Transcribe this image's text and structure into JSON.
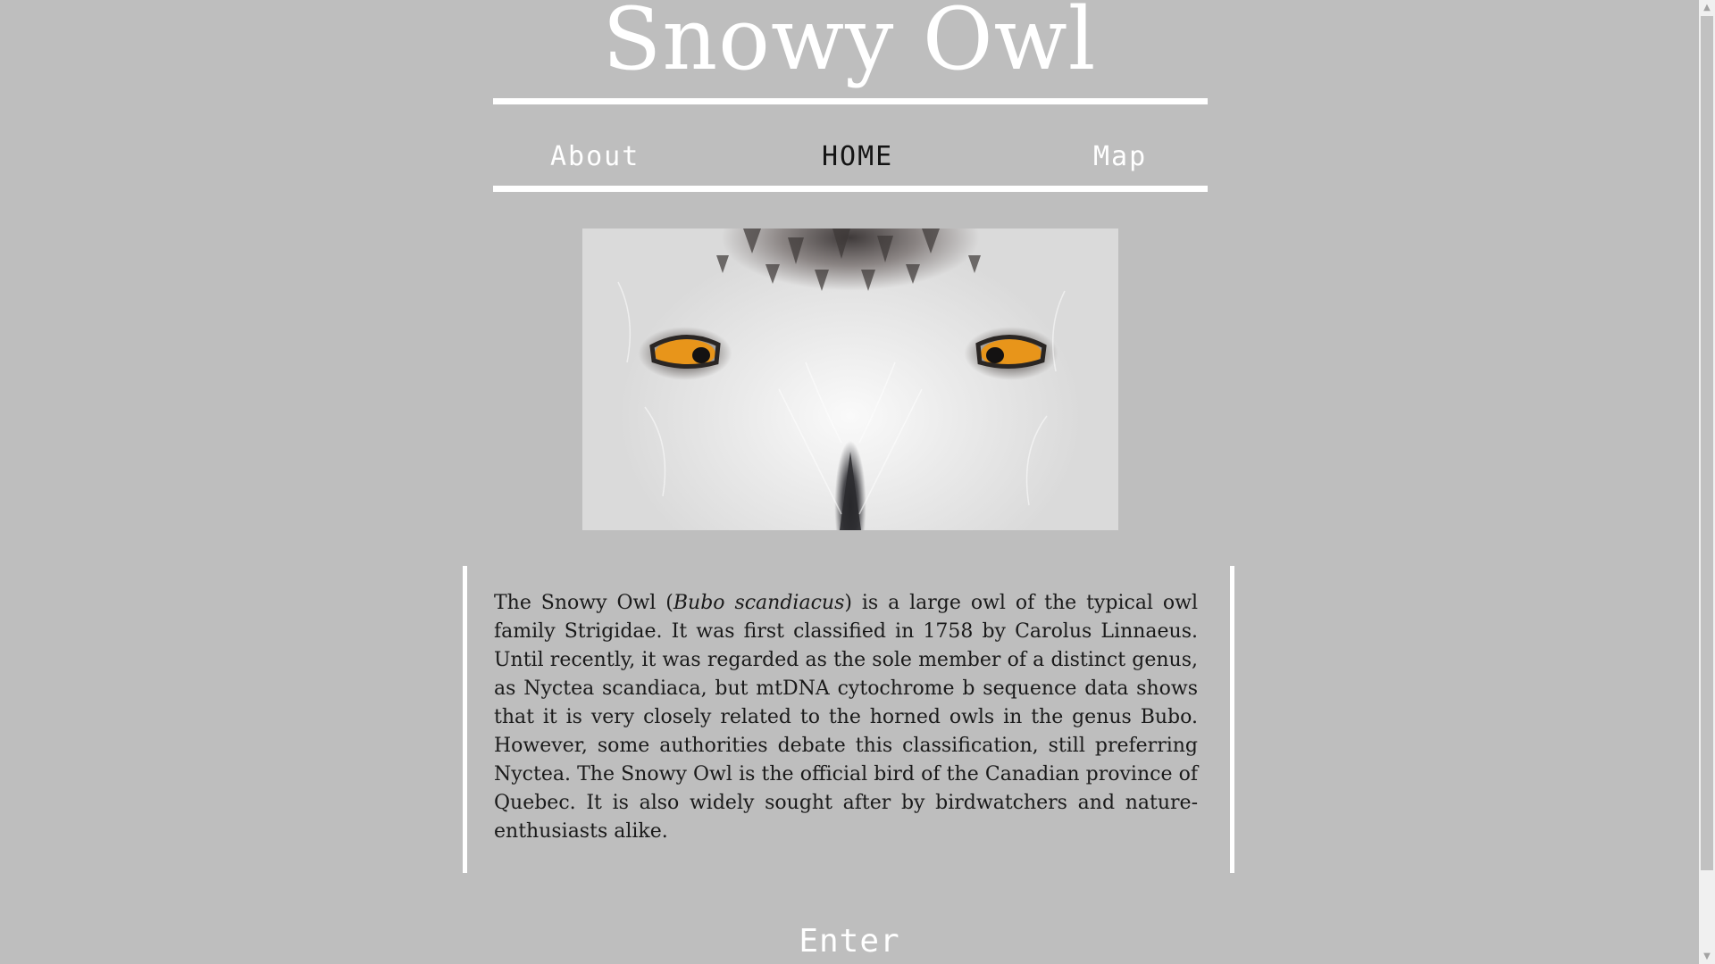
{
  "site": {
    "title": "Snowy Owl"
  },
  "nav": {
    "items": [
      {
        "label": "About",
        "active": false
      },
      {
        "label": "HOME",
        "active": true
      },
      {
        "label": "Map",
        "active": false
      }
    ]
  },
  "hero": {
    "image_name": "snowy-owl-face-photo",
    "eye_color": "#e8951a"
  },
  "description": {
    "before_italic": "The Snowy Owl (",
    "italic": "Bubo scandiacus",
    "after_italic": ") is a large owl of the typical owl family Strigidae. It was first classified in 1758 by Carolus Linnaeus. Until recently, it was regarded as the sole member of a distinct genus, as Nyctea scandiaca, but mtDNA cytochrome b sequence data shows that it is very closely related to the horned owls in the genus Bubo. However, some authorities debate this classification, still preferring Nyctea. The Snowy Owl is the official bird of the Canadian province of Quebec. It is also widely sought after by birdwatchers and nature-enthusiasts alike."
  },
  "enter_label": "Enter",
  "scrollbar": {
    "up_icon": "scroll-up-arrow-icon",
    "down_icon": "scroll-down-arrow-icon"
  },
  "colors": {
    "background": "#bebebe",
    "accent": "#ffffff",
    "active_nav": "#141414"
  }
}
